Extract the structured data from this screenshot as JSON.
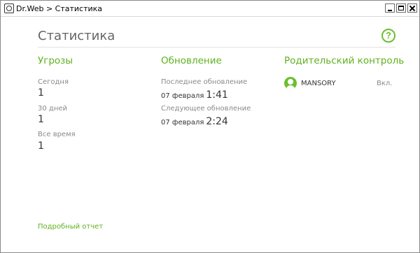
{
  "window": {
    "title": "Dr.Web > Статистика"
  },
  "page": {
    "title": "Статистика",
    "help_icon": "?"
  },
  "threats": {
    "title": "Угрозы",
    "today_label": "Сегодня",
    "today_value": "1",
    "days30_label": "30 дней",
    "days30_value": "1",
    "alltime_label": "Все время",
    "alltime_value": "1"
  },
  "update": {
    "title": "Обновление",
    "last_label": "Последнее обновление",
    "last_date": "07 февраля",
    "last_time": "1:41",
    "next_label": "Следующее обновление",
    "next_date": "07 февраля",
    "next_time": "2:24"
  },
  "parental": {
    "title": "Родительский контроль",
    "user_name": "MANSORY",
    "user_status": "Вкл."
  },
  "footer": {
    "report_link": "Подробный отчет"
  },
  "colors": {
    "accent": "#5fb21f",
    "title_gray": "#666666",
    "label_gray": "#8a8a8a"
  },
  "icons": {
    "app": "drweb-spider-icon",
    "help": "help-circle-icon",
    "user": "user-avatar-icon"
  }
}
